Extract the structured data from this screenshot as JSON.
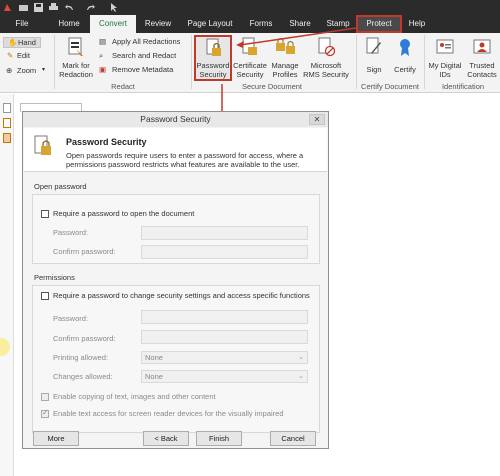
{
  "menu": {
    "file": "File",
    "tabs": [
      "Home",
      "Convert",
      "Review",
      "Page Layout",
      "Forms",
      "Share",
      "Stamp",
      "Protect",
      "Help"
    ]
  },
  "ribbon": {
    "hand": "Hand",
    "edit": "Edit",
    "zoom": "Zoom",
    "mark_for_redaction": [
      "Mark for",
      "Redaction"
    ],
    "apply_all_redactions": "Apply All Redactions",
    "search_and_redact": "Search and Redact",
    "remove_metadata": "Remove Metadata",
    "redact_group": "Redact",
    "password_security": [
      "Password",
      "Security"
    ],
    "certificate_security": [
      "Certificate",
      "Security"
    ],
    "manage_profiles": [
      "Manage",
      "Profiles"
    ],
    "microsoft_rms": [
      "Microsoft",
      "RMS Security"
    ],
    "secure_group": "Secure Document",
    "sign": "Sign",
    "certify": "Certify",
    "certify_group": "Certify Document",
    "my_digital_ids": [
      "My Digital",
      "IDs"
    ],
    "trusted_contacts": [
      "Trusted",
      "Contacts"
    ],
    "identification_group": "Identification"
  },
  "dialog": {
    "title": "Password Security",
    "heading": "Password Security",
    "description": "Open passwords require users to enter a password for access, where a permissions password restricts what features are available to the user.",
    "open_password": {
      "section_label": "Open password",
      "require_checkbox": "Require a password to open the document",
      "password_label": "Password:",
      "confirm_label": "Confirm password:"
    },
    "permissions": {
      "section_label": "Permissions",
      "require_checkbox": "Require a password to change security settings and access specific functions",
      "password_label": "Password:",
      "confirm_label": "Confirm password:",
      "printing_label": "Printing allowed:",
      "printing_value": "None",
      "changes_label": "Changes allowed:",
      "changes_value": "None",
      "enable_copying": "Enable copying of text, images and other content",
      "enable_copying_checked": false,
      "enable_text_access": "Enable text access for screen reader devices for the visually impaired",
      "enable_text_access_checked": true
    },
    "buttons": {
      "more": "More",
      "back": "< Back",
      "finish": "Finish",
      "cancel": "Cancel"
    }
  },
  "colors": {
    "highlight_red": "#c0392b",
    "ribbon_bg": "#f3f3f3",
    "menu_bg": "#2b2b2b",
    "lock_gold": "#d8a531"
  }
}
